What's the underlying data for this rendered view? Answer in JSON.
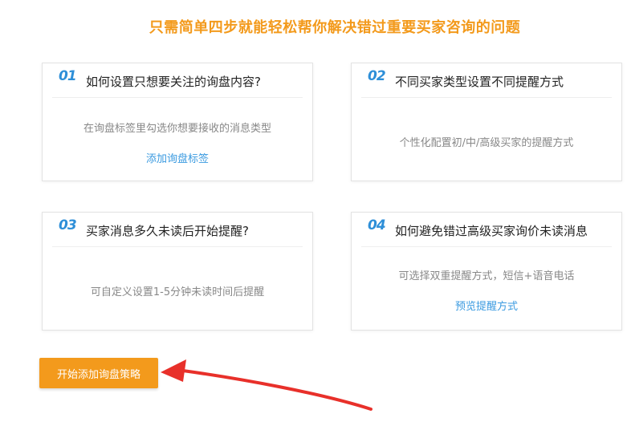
{
  "headline": "只需简单四步就能轻松帮你解决错过重要买家咨询的问题",
  "cards": [
    {
      "num": "01",
      "title": "如何设置只想要关注的询盘内容?",
      "desc": "在询盘标签里勾选你想要接收的消息类型",
      "link": "添加询盘标签"
    },
    {
      "num": "02",
      "title": "不同买家类型设置不同提醒方式",
      "desc": "个性化配置初/中/高级买家的提醒方式"
    },
    {
      "num": "03",
      "title": "买家消息多久未读后开始提醒?",
      "desc": "可自定义设置1-5分钟未读时间后提醒"
    },
    {
      "num": "04",
      "title": "如何避免错过高级买家询价未读消息",
      "desc": "可选择双重提醒方式，短信+语音电话",
      "link": "预览提醒方式"
    }
  ],
  "start_button": "开始添加询盘策略",
  "colors": {
    "accent": "#f39a1c",
    "step_number": "#2e8fd8",
    "link": "#3a9ae0",
    "annotation_arrow": "#e8302a"
  }
}
